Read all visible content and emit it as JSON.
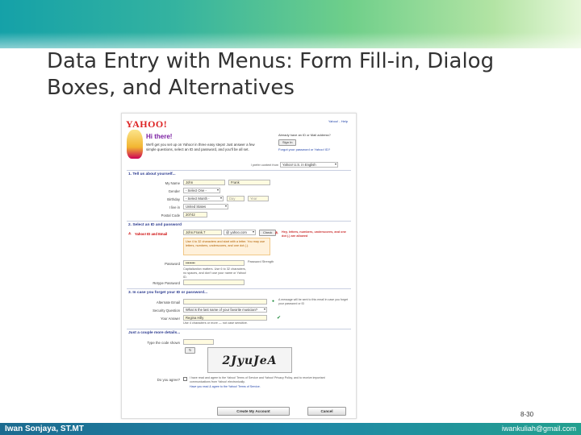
{
  "slide": {
    "title": "Data Entry with Menus: Form Fill-in, Dialog Boxes, and Alternatives",
    "number": "8-30",
    "footer_author": "Iwan Sonjaya, ST.MT",
    "footer_email": "iwankuliah@gmail.com"
  },
  "form": {
    "logo": "YAHOO!",
    "greeting": "Hi there!",
    "intro": "We'll get you set up on Yahoo! in three easy steps! Just answer a few simple questions, select an ID and password, and you'll be all set.",
    "top_links": "Yahoo! - Help",
    "signin_prompt": "Already have an ID or Mail address?",
    "signin_button": "Sign In",
    "forgot_link": "Forgot your password or Yahoo! ID?",
    "content_from_label": "I prefer content from",
    "content_from_value": "Yahoo! U.S. in English",
    "section1": "1. Tell us about yourself...",
    "my_name_label": "My Name",
    "first_name": "John",
    "last_name": "Frank",
    "gender_label": "Gender",
    "gender_value": "- Select One -",
    "birthday_label": "Birthday",
    "birthday_month": "- Select Month -",
    "birthday_day": "Day",
    "birthday_year": "Year",
    "live_in_label": "I live in",
    "live_in_value": "United States",
    "postal_label": "Postal Code",
    "postal_value": "20742",
    "section2": "2. Select an ID and password",
    "id_label": "Yahoo! ID and Email",
    "id_value": "John.Frank.7",
    "id_domain": "@ yahoo.com",
    "check_button": "Check",
    "id_tip": "Hey, letters, numbers, underscores, and one dot (.) are allowed",
    "id_hint": "Use 4 to 32 characters and start with a letter. You may use letters, numbers, underscores, and one dot (.).",
    "password_label": "Password",
    "password_value": "••••••••",
    "password_strength": "Password Strength",
    "password_hint": "Capitalization matters. Use 6 to 32 characters, no spaces, and don't use your name or Yahoo! ID.",
    "retype_label": "Retype Password",
    "section3": "3. In case you forget your ID or password...",
    "alt_email_label": "Alternate Email",
    "security_q_label": "Security Question",
    "security_q_value": "What is the last name of your favorite musician?",
    "answer_label": "Your Answer",
    "answer_value": "Regina Hilly",
    "security_tip": "A message will be sent to this email in case you forget your password or ID",
    "answer_hint": "Use 4 characters or more — not case sensitive.",
    "section4": "Just a couple more details...",
    "captcha_label": "Type the code shown",
    "captcha_text": "2JyuJeA",
    "agree_label": "Do you agree?",
    "agree_text": "I have read and agree to the Yahoo! Terms of Service and Yahoo! Privacy Policy, and to receive important communications from Yahoo! electronically.",
    "agree_note": "Have you read & agree to the Yahoo! Terms of Service.",
    "create_button": "Create My Account",
    "cancel_button": "Cancel"
  }
}
